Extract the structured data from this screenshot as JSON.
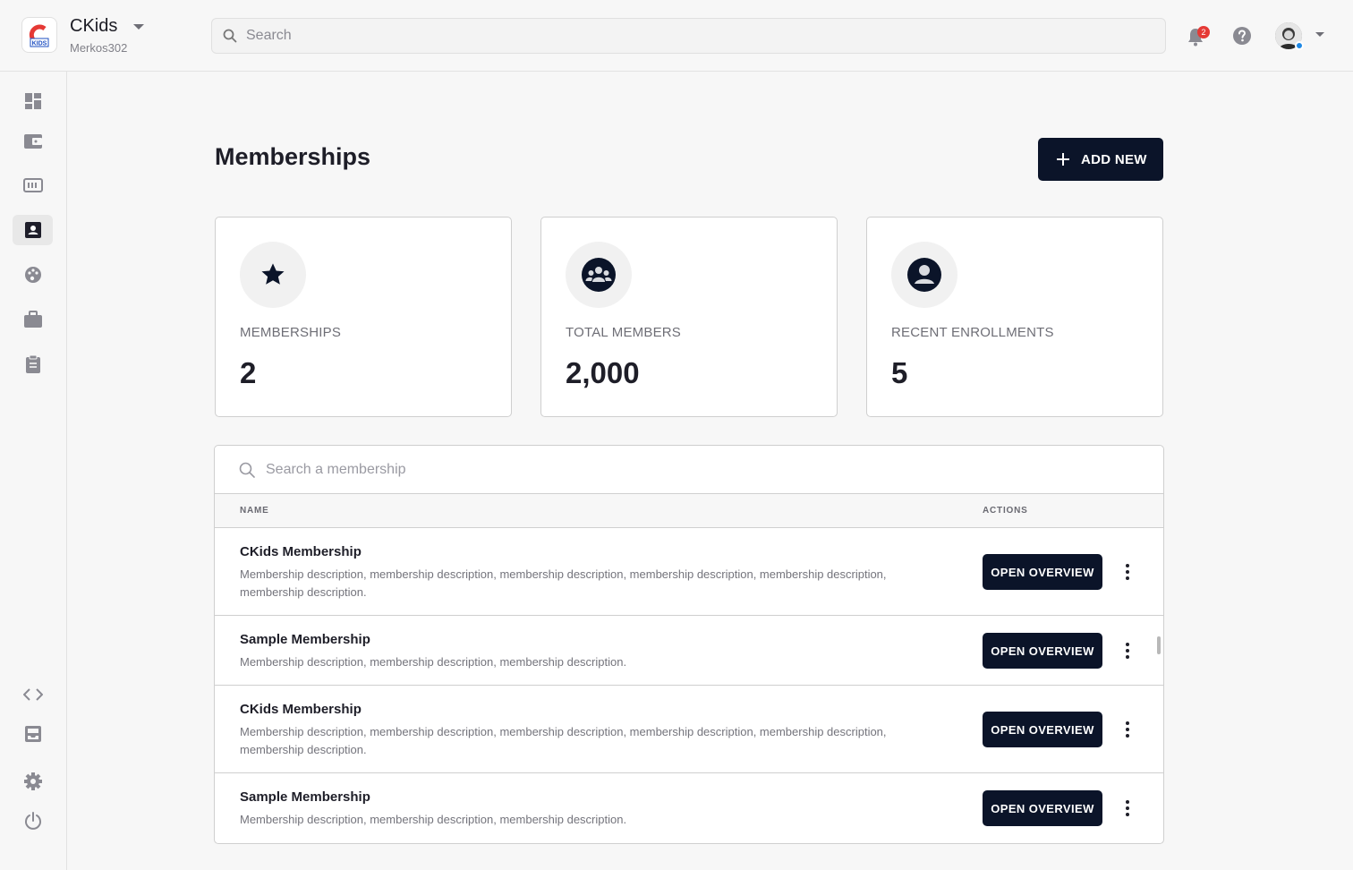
{
  "header": {
    "org_name": "CKids",
    "org_user": "Merkos302",
    "logo_text": "KIDS",
    "search_placeholder": "Search",
    "notification_count": "2"
  },
  "sidebar": {
    "items": [
      {
        "icon": "dashboard-icon"
      },
      {
        "icon": "wallet-icon"
      },
      {
        "icon": "ticket-icon"
      },
      {
        "icon": "contact-card-icon",
        "active": true
      },
      {
        "icon": "palette-icon"
      },
      {
        "icon": "briefcase-icon"
      },
      {
        "icon": "clipboard-icon"
      }
    ],
    "bottom_items": [
      {
        "icon": "code-icon"
      },
      {
        "icon": "inbox-icon"
      },
      {
        "icon": "gear-icon"
      },
      {
        "icon": "power-icon"
      }
    ]
  },
  "page": {
    "title": "Memberships",
    "add_label": "ADD NEW"
  },
  "stats": [
    {
      "label": "MEMBERSHIPS",
      "value": "2",
      "icon": "star-icon"
    },
    {
      "label": "TOTAL MEMBERS",
      "value": "2,000",
      "icon": "group-icon"
    },
    {
      "label": "RECENT ENROLLMENTS",
      "value": "5",
      "icon": "person-icon"
    }
  ],
  "table": {
    "search_placeholder": "Search a membership",
    "columns": {
      "name": "NAME",
      "actions": "ACTIONS"
    },
    "open_label": "OPEN OVERVIEW",
    "rows": [
      {
        "title": "CKids Membership",
        "description": "Membership description, membership description, membership description, membership description, membership description, membership description."
      },
      {
        "title": "Sample Membership",
        "description": "Membership description, membership description, membership description."
      },
      {
        "title": "CKids Membership",
        "description": "Membership description, membership description, membership description, membership description, membership description, membership description."
      },
      {
        "title": "Sample Membership",
        "description": "Membership description, membership description, membership description."
      }
    ]
  },
  "colors": {
    "primary": "#0b1429",
    "badge": "#e53935",
    "online": "#1e88e5",
    "logo_red": "#e53935",
    "logo_blue": "#1e4fc2"
  }
}
